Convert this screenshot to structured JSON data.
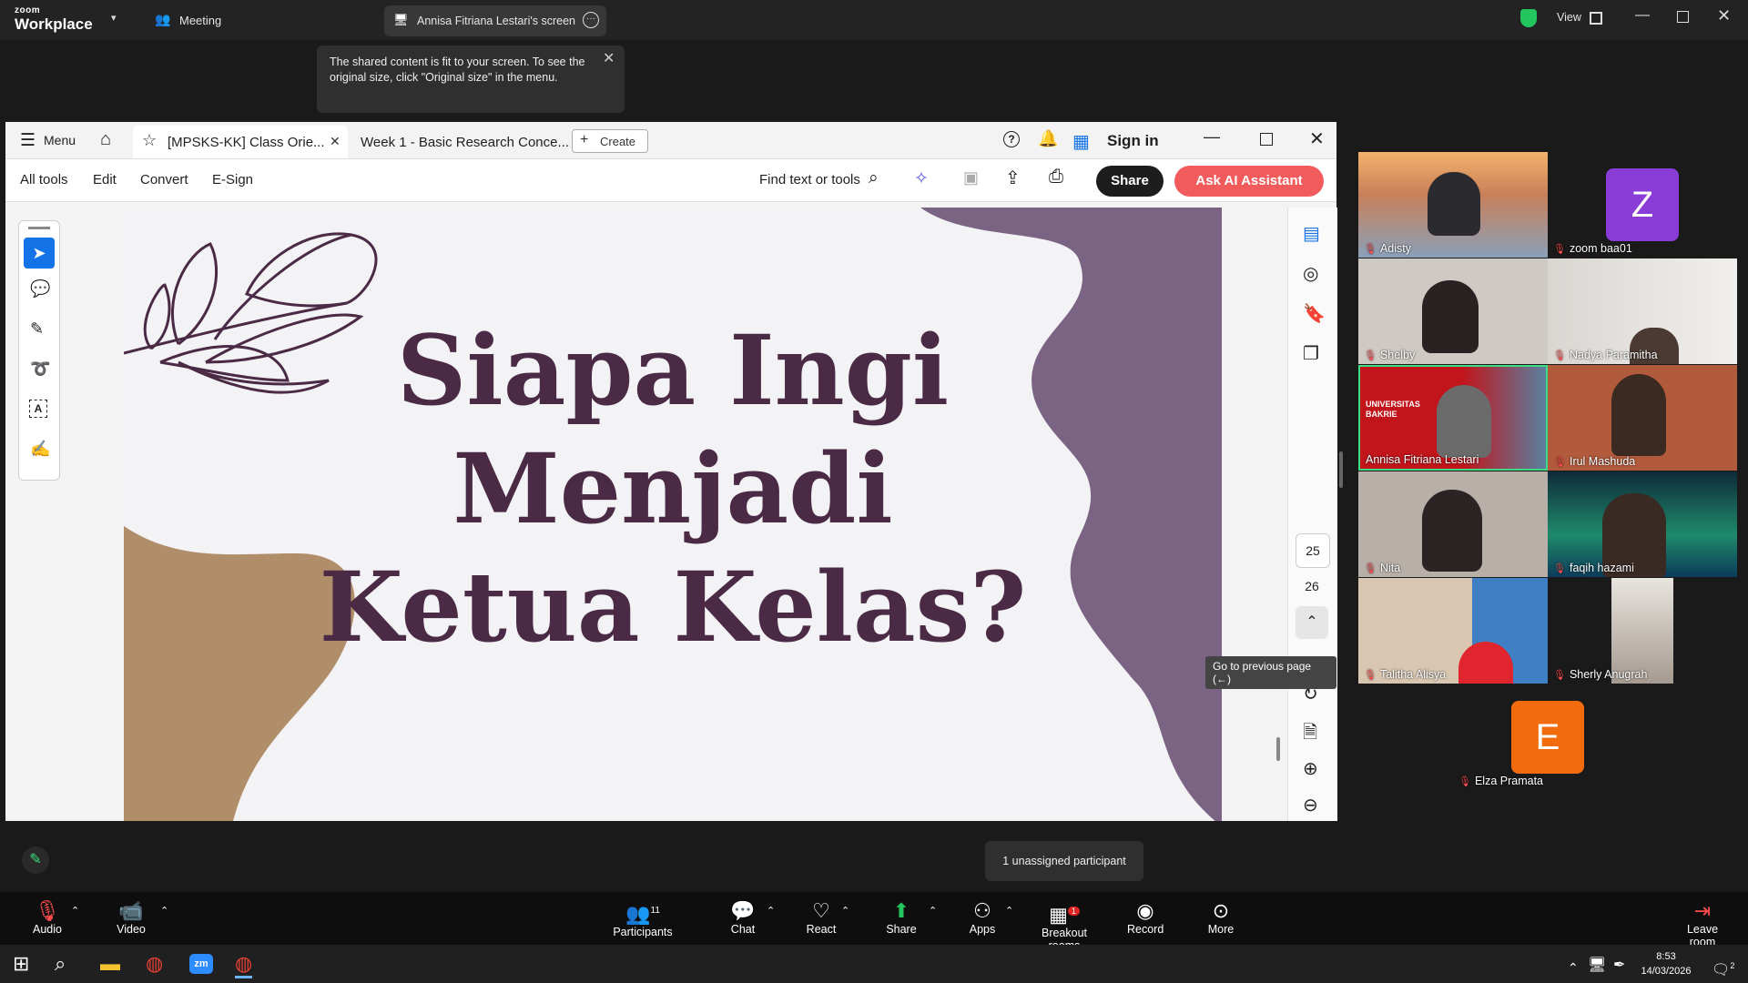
{
  "zoom_top": {
    "logo_small": "zoom",
    "logo_big": "Workplace",
    "meeting_label": "Meeting",
    "screen_title": "Annisa Fitriana Lestari's screen",
    "view_label": "View"
  },
  "tooltip": {
    "text": "The shared content is fit to your screen. To see the original size, click \"Original size\" in the menu."
  },
  "acrobat": {
    "menu_label": "Menu",
    "tabs": [
      {
        "label": "[MPSKS-KK] Class Orie..."
      },
      {
        "label": "Week 1 - Basic Research Conce..."
      }
    ],
    "create_label": "Create",
    "sign_in": "Sign in",
    "tools": [
      "All tools",
      "Edit",
      "Convert",
      "E-Sign"
    ],
    "find_label": "Find text or tools",
    "share_label": "Share",
    "ai_label": "Ask AI Assistant",
    "page_current": "25",
    "page_next": "26",
    "prev_tooltip": "Go to previous page (←)"
  },
  "slide": {
    "line1": "Siapa Ingi",
    "line2": "Menjadi",
    "line3": "Ketua Kelas?"
  },
  "participants": [
    {
      "name": "Adisty"
    },
    {
      "name": "zoom baa01",
      "initial": "Z"
    },
    {
      "name": "Shelby"
    },
    {
      "name": "Nadya Paramitha"
    },
    {
      "name": "Annisa Fitriana Lestari",
      "banner": "UNIVERSITAS BAKRIE"
    },
    {
      "name": "Irul Mashuda"
    },
    {
      "name": "Nita"
    },
    {
      "name": "faqih hazami"
    },
    {
      "name": "Talitha Alisya"
    },
    {
      "name": "Sherly Anugrah"
    },
    {
      "name": "Elza Pramata",
      "initial": "E"
    }
  ],
  "unassigned": "1 unassigned participant",
  "toolbar": {
    "audio": "Audio",
    "video": "Video",
    "participants": "Participants",
    "participants_count": "11",
    "chat": "Chat",
    "react": "React",
    "share": "Share",
    "apps": "Apps",
    "breakout": "Breakout rooms",
    "breakout_badge": "1",
    "record": "Record",
    "more": "More",
    "leave": "Leave room"
  },
  "taskbar": {
    "time": "8:53",
    "date": "14/03/2026",
    "notif": "2"
  },
  "colors": {
    "slide_text": "#4a2a45",
    "blob_purple": "#7b6384",
    "blob_tan": "#b08e6a",
    "ai_button": "#f15b5b",
    "zoom_share_green": "#22c55e"
  }
}
